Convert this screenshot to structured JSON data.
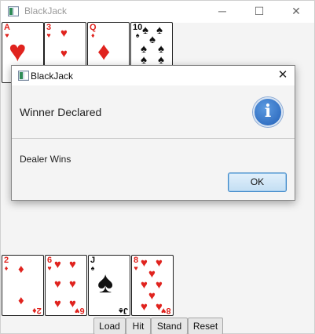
{
  "window": {
    "title": "BlackJack",
    "minimize_glyph": "─",
    "maximize_glyph": "☐",
    "close_glyph": "✕"
  },
  "dealer_cards": [
    {
      "rank": "A",
      "suit": "♥",
      "color": "#e0231e"
    },
    {
      "rank": "3",
      "suit": "♥",
      "color": "#e0231e"
    },
    {
      "rank": "Q",
      "suit": "♦",
      "color": "#e0231e"
    },
    {
      "rank": "10",
      "suit": "♠",
      "color": "#111111"
    }
  ],
  "player_cards": [
    {
      "rank": "2",
      "suit": "♦",
      "color": "#e0231e"
    },
    {
      "rank": "6",
      "suit": "♥",
      "color": "#e0231e"
    },
    {
      "rank": "J",
      "suit": "♠",
      "color": "#111111"
    },
    {
      "rank": "8",
      "suit": "♥",
      "color": "#e0231e"
    }
  ],
  "dialog": {
    "title": "BlackJack",
    "close_glyph": "✕",
    "heading": "Winner Declared",
    "icon": "info-icon",
    "icon_glyph": "i",
    "message": "Dealer Wins",
    "ok_label": "OK"
  },
  "buttons": {
    "load": "Load",
    "hit": "Hit",
    "stand": "Stand",
    "reset": "Reset"
  },
  "colors": {
    "heart_diamond": "#e0231e",
    "spade": "#111111",
    "info_blue": "#2361b8",
    "ok_border": "#3a85c6"
  }
}
